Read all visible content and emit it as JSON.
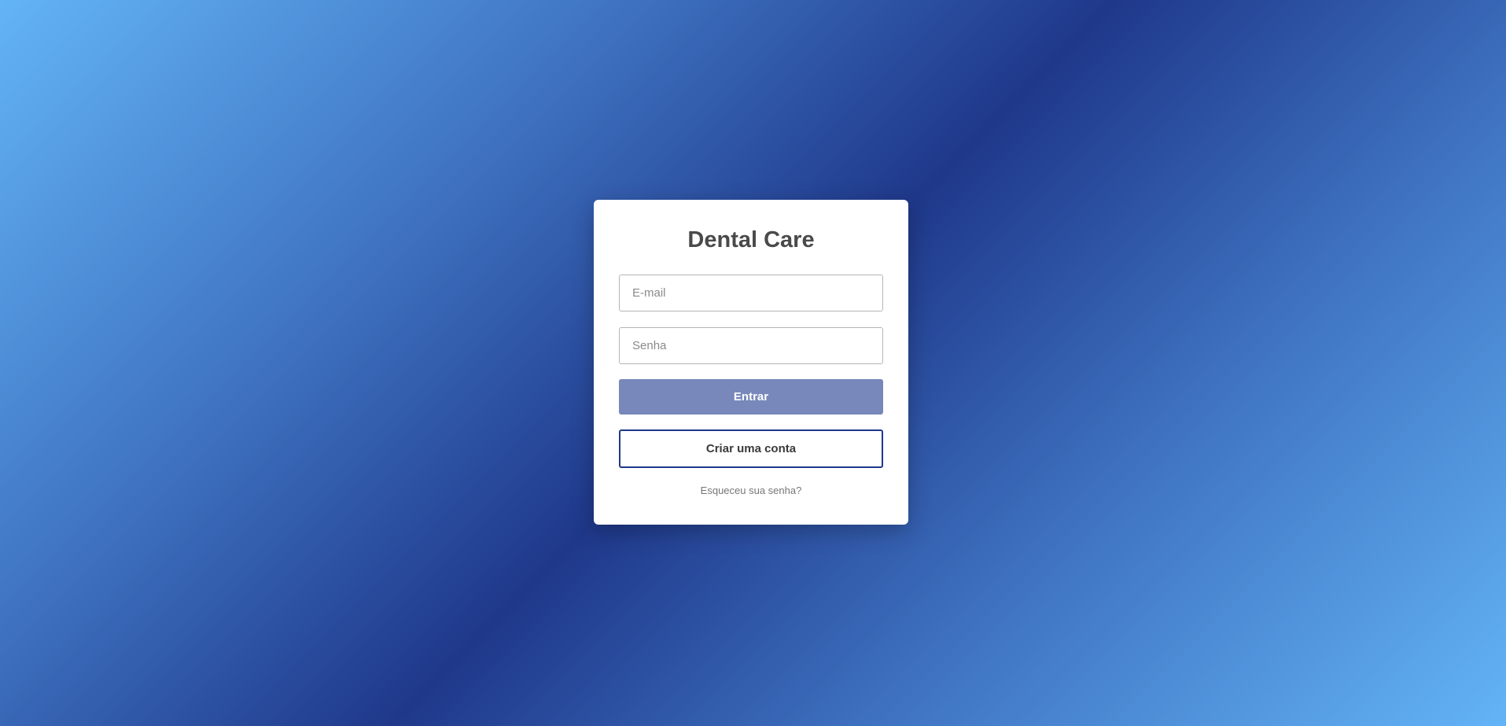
{
  "login": {
    "title": "Dental Care",
    "email_placeholder": "E-mail",
    "password_placeholder": "Senha",
    "login_label": "Entrar",
    "create_account_label": "Criar uma conta",
    "forgot_password_label": "Esqueceu sua senha?"
  },
  "colors": {
    "primary": "#1f388a",
    "login_button": "#7888bb",
    "gradient_light": "#63b4f6"
  }
}
